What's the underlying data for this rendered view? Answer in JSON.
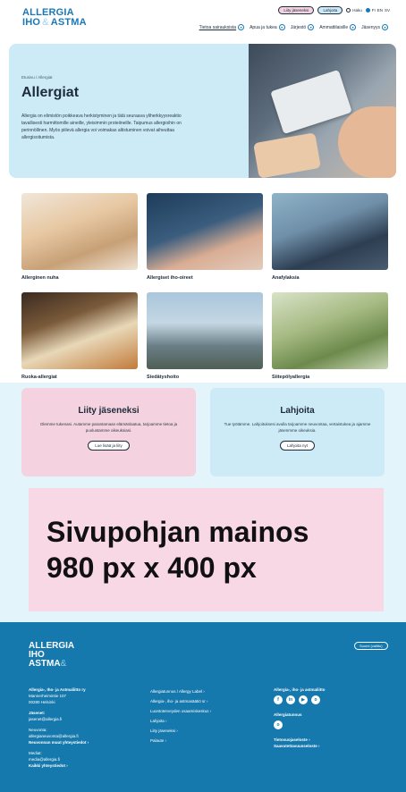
{
  "header": {
    "logo_line1": "ALLERGIA",
    "logo_line2a": "IHO",
    "logo_amp": "&",
    "logo_line2b": "ASTMA",
    "join_pill": "Liity jäseneksi",
    "donate_pill": "Lahjoita",
    "search_label": "Haku",
    "lang_fi": "FI",
    "lang_en": "EN",
    "lang_sv": "SV",
    "nav": [
      {
        "label": "Tietoa sairauksista"
      },
      {
        "label": "Apua ja tukea"
      },
      {
        "label": "Järjestö"
      },
      {
        "label": "Ammattilaisille"
      },
      {
        "label": "Jäsenyys"
      }
    ]
  },
  "hero": {
    "breadcrumb": "Etusivu / Allergiat",
    "title": "Allergiat",
    "text": "Allergia on elimistön poikkeava herkistyminen ja tätä seuraava yliherkkyysreaktio tavallisesti harmittomille aineille, yleisimmin proteiineille. Taipumus allergioihin on perinnöllinen. Myös piilevä allergia voi voimakas altistuminen voivat aiheuttaa allergisoitumista."
  },
  "cards": [
    {
      "label": "Allerginen nuha",
      "icon": "photo-sneezing-woman"
    },
    {
      "label": "Allergiset iho-oireet",
      "icon": "photo-skin-scratching"
    },
    {
      "label": "Anafylaksia",
      "icon": "photo-adrenaline-pen"
    },
    {
      "label": "Ruoka-allergiat",
      "icon": "photo-food-table"
    },
    {
      "label": "Siedätyshoito",
      "icon": "photo-birch-trees"
    },
    {
      "label": "Siitepölyallergia",
      "icon": "photo-birch-catkins"
    }
  ],
  "cta": {
    "join_title": "Liity jäseneksi",
    "join_text": "Olemme tukenasi. Autamme parantamaan elämänlaatua, tarjoamme tietoa ja puolustamme oikeuksiasi.",
    "join_button": "Lue lisää ja liity",
    "donate_title": "Lahjoita",
    "donate_text": "Tue työtämme. Lahjoituksesi avulla tarjoamme neuvontaa, vertaistukea ja ajamme jäsenmme oikeuksia.",
    "donate_button": "Lahjoita nyt"
  },
  "ad": {
    "line1": "Sivupohjan mainos",
    "line2": "980 px x 400 px"
  },
  "footer": {
    "logo_line1": "ALLERGIA",
    "logo_line2": "IHO",
    "logo_line3": "ASTMA",
    "logo_amp": "&",
    "lang_button": "Suomi (valittu)",
    "col1": {
      "org": "Allergia-, Iho- ja Astmaliitto ry",
      "address1": "Mannerheimintie 107",
      "address2": "00280 Helsinki",
      "members_label": "Jäsenet:",
      "members_email": "jasenet@allergia.fi",
      "advice_label": "Neuvonta:",
      "advice_email": "allergianeuvonta@allergia.fi",
      "advice_link": "Neuvonnan muut yhteystiedot",
      "media_label": "Mediat:",
      "media_email": "media@allergia.fi",
      "all_contacts": "Kaikki yhteystiedot"
    },
    "col2": [
      "Allergiatunnus / Allergy Label",
      "Allergia-, iho- ja astmasäätiö sr",
      "Luontoterveyden osaamiskeskus",
      "Lahjoita",
      "Liity jäseneksi",
      "Palaute"
    ],
    "col3": {
      "social_title": "Allergia-, iho- ja astmaliitto",
      "social": [
        "f",
        "in",
        "▶",
        "o"
      ],
      "label_title": "Allergiatunnus",
      "label_social": [
        "o"
      ],
      "privacy": "Tietosuojaseloste",
      "accessibility": "Saavutettavuusseloste"
    }
  }
}
